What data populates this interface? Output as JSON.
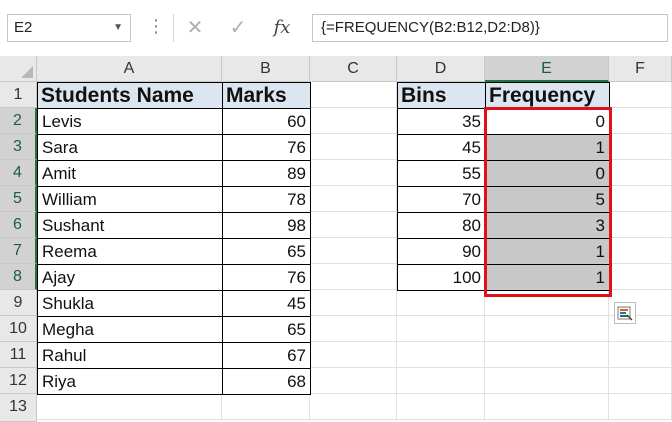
{
  "formula_bar": {
    "name_box": "E2",
    "cancel_icon": "close-icon",
    "enter_icon": "check-icon",
    "fx_label": "fx",
    "formula": "{=FREQUENCY(B2:B12,D2:D8)}"
  },
  "columns": [
    "A",
    "B",
    "C",
    "D",
    "E",
    "F"
  ],
  "rows": [
    "1",
    "2",
    "3",
    "4",
    "5",
    "6",
    "7",
    "8",
    "9",
    "10",
    "11",
    "12",
    "13"
  ],
  "table_students": {
    "header_name": "Students Name",
    "header_marks": "Marks",
    "rows": [
      {
        "name": "Levis",
        "marks": "60"
      },
      {
        "name": "Sara",
        "marks": "76"
      },
      {
        "name": "Amit",
        "marks": "89"
      },
      {
        "name": "William",
        "marks": "78"
      },
      {
        "name": "Sushant",
        "marks": "98"
      },
      {
        "name": "Reema",
        "marks": "65"
      },
      {
        "name": "Ajay",
        "marks": "76"
      },
      {
        "name": "Shukla",
        "marks": "45"
      },
      {
        "name": "Megha",
        "marks": "65"
      },
      {
        "name": "Rahul",
        "marks": "67"
      },
      {
        "name": "Riya",
        "marks": "68"
      }
    ]
  },
  "table_frequency": {
    "header_bins": "Bins",
    "header_frequency": "Frequency",
    "rows": [
      {
        "bin": "35",
        "frequency": "0"
      },
      {
        "bin": "45",
        "frequency": "1"
      },
      {
        "bin": "55",
        "frequency": "0"
      },
      {
        "bin": "70",
        "frequency": "5"
      },
      {
        "bin": "80",
        "frequency": "3"
      },
      {
        "bin": "90",
        "frequency": "1"
      },
      {
        "bin": "100",
        "frequency": "1"
      }
    ]
  },
  "selected_cell": "E2",
  "highlight_color": "#e0111b",
  "quick_analysis_icon": "quick-analysis-icon"
}
